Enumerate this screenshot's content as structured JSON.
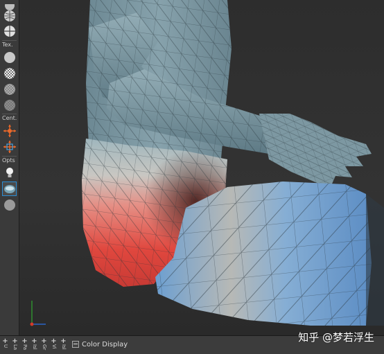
{
  "toolbar": {
    "sections": [
      {
        "label": "Tex."
      },
      {
        "label": "Cent."
      },
      {
        "label": "Opts"
      }
    ]
  },
  "bottom_bar": {
    "tabs": [
      {
        "label": "U"
      },
      {
        "label": "La"
      },
      {
        "label": "Pa"
      },
      {
        "label": "Isl"
      },
      {
        "label": "Gr"
      },
      {
        "label": "Vi"
      },
      {
        "label": "Isl"
      }
    ],
    "color_display_label": "Color Display"
  },
  "watermark": "知乎 @梦若浮生",
  "colors": {
    "mesh_blue_gray": "#7e9aa4",
    "heat_red": "#e0473e",
    "heat_blue": "#6fa3d6",
    "toolbar_bg": "#3a3a3a",
    "viewport_bg": "#2d2d2d"
  }
}
